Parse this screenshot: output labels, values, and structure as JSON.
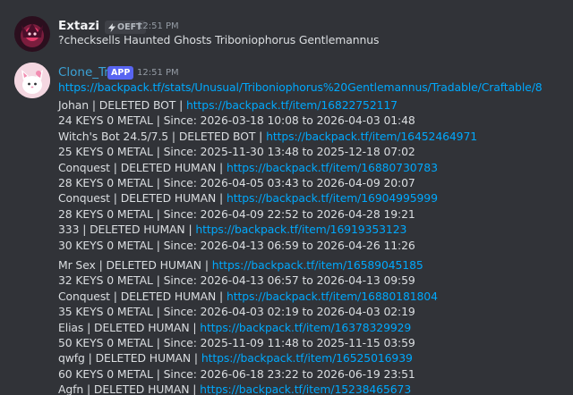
{
  "messages": [
    {
      "author": "Extazi",
      "tag": "OEFT",
      "timestamp": "12:51 PM",
      "content": "?checksells Haunted Ghosts Triboniophorus Gentlemannus"
    },
    {
      "author": "Clone_Tri",
      "badge": "APP",
      "timestamp": "12:51 PM",
      "url": "https://backpack.tf/stats/Unusual/Triboniophorus%20Gentlemannus/Tradable/Craftable/8",
      "entries": [
        {
          "seller": "Johan | DELETED BOT | ",
          "link": "https://backpack.tf/item/16822752117",
          "detail": "24 KEYS 0 METAL | Since: 2026-03-18 10:08 to 2026-04-03 01:48"
        },
        {
          "seller": "Witch's Bot 24.5/7.5 | DELETED BOT | ",
          "link": "https://backpack.tf/item/16452464971",
          "detail": "25 KEYS 0 METAL | Since: 2025-11-30 13:48 to 2025-12-18 07:02"
        },
        {
          "seller": "Conquest | DELETED HUMAN | ",
          "link": "https://backpack.tf/item/16880730783",
          "detail": "28 KEYS 0 METAL | Since: 2026-04-05 03:43 to 2026-04-09 20:07"
        },
        {
          "seller": "Conquest | DELETED HUMAN | ",
          "link": "https://backpack.tf/item/16904995999",
          "detail": "28 KEYS 0 METAL | Since: 2026-04-09 22:52 to 2026-04-28 19:21"
        },
        {
          "seller": "333 | DELETED HUMAN | ",
          "link": "https://backpack.tf/item/16919353123",
          "detail": "30 KEYS 0 METAL | Since: 2026-04-13 06:59 to 2026-04-26 11:26"
        },
        {
          "seller": "Mr Sex | DELETED HUMAN | ",
          "link": "https://backpack.tf/item/16589045185",
          "detail": "32 KEYS 0 METAL | Since: 2026-04-13 06:57 to 2026-04-13 09:59"
        },
        {
          "seller": "Conquest | DELETED HUMAN | ",
          "link": "https://backpack.tf/item/16880181804",
          "detail": "35 KEYS 0 METAL | Since: 2026-04-03 02:19 to 2026-04-03 02:19"
        },
        {
          "seller": "Elias | DELETED HUMAN | ",
          "link": "https://backpack.tf/item/16378329929",
          "detail": "50 KEYS 0 METAL | Since: 2025-11-09 11:48 to 2025-11-15 03:59"
        },
        {
          "seller": "qwfg | DELETED HUMAN | ",
          "link": "https://backpack.tf/item/16525016939",
          "detail": "60 KEYS 0 METAL | Since: 2026-06-18 23:22 to 2026-06-19 23:51"
        },
        {
          "seller": "Agfn | DELETED HUMAN | ",
          "link": "https://backpack.tf/item/15238465673",
          "detail": ""
        }
      ]
    }
  ],
  "icons": [
    "avatar-extazi",
    "lightning-icon",
    "avatar-clone-tri"
  ],
  "colors": {
    "background": "#313338",
    "link": "#00a8fc",
    "app_badge": "#5865f2",
    "author1": "#f2f3f5",
    "author2": "#3ba2d6"
  }
}
